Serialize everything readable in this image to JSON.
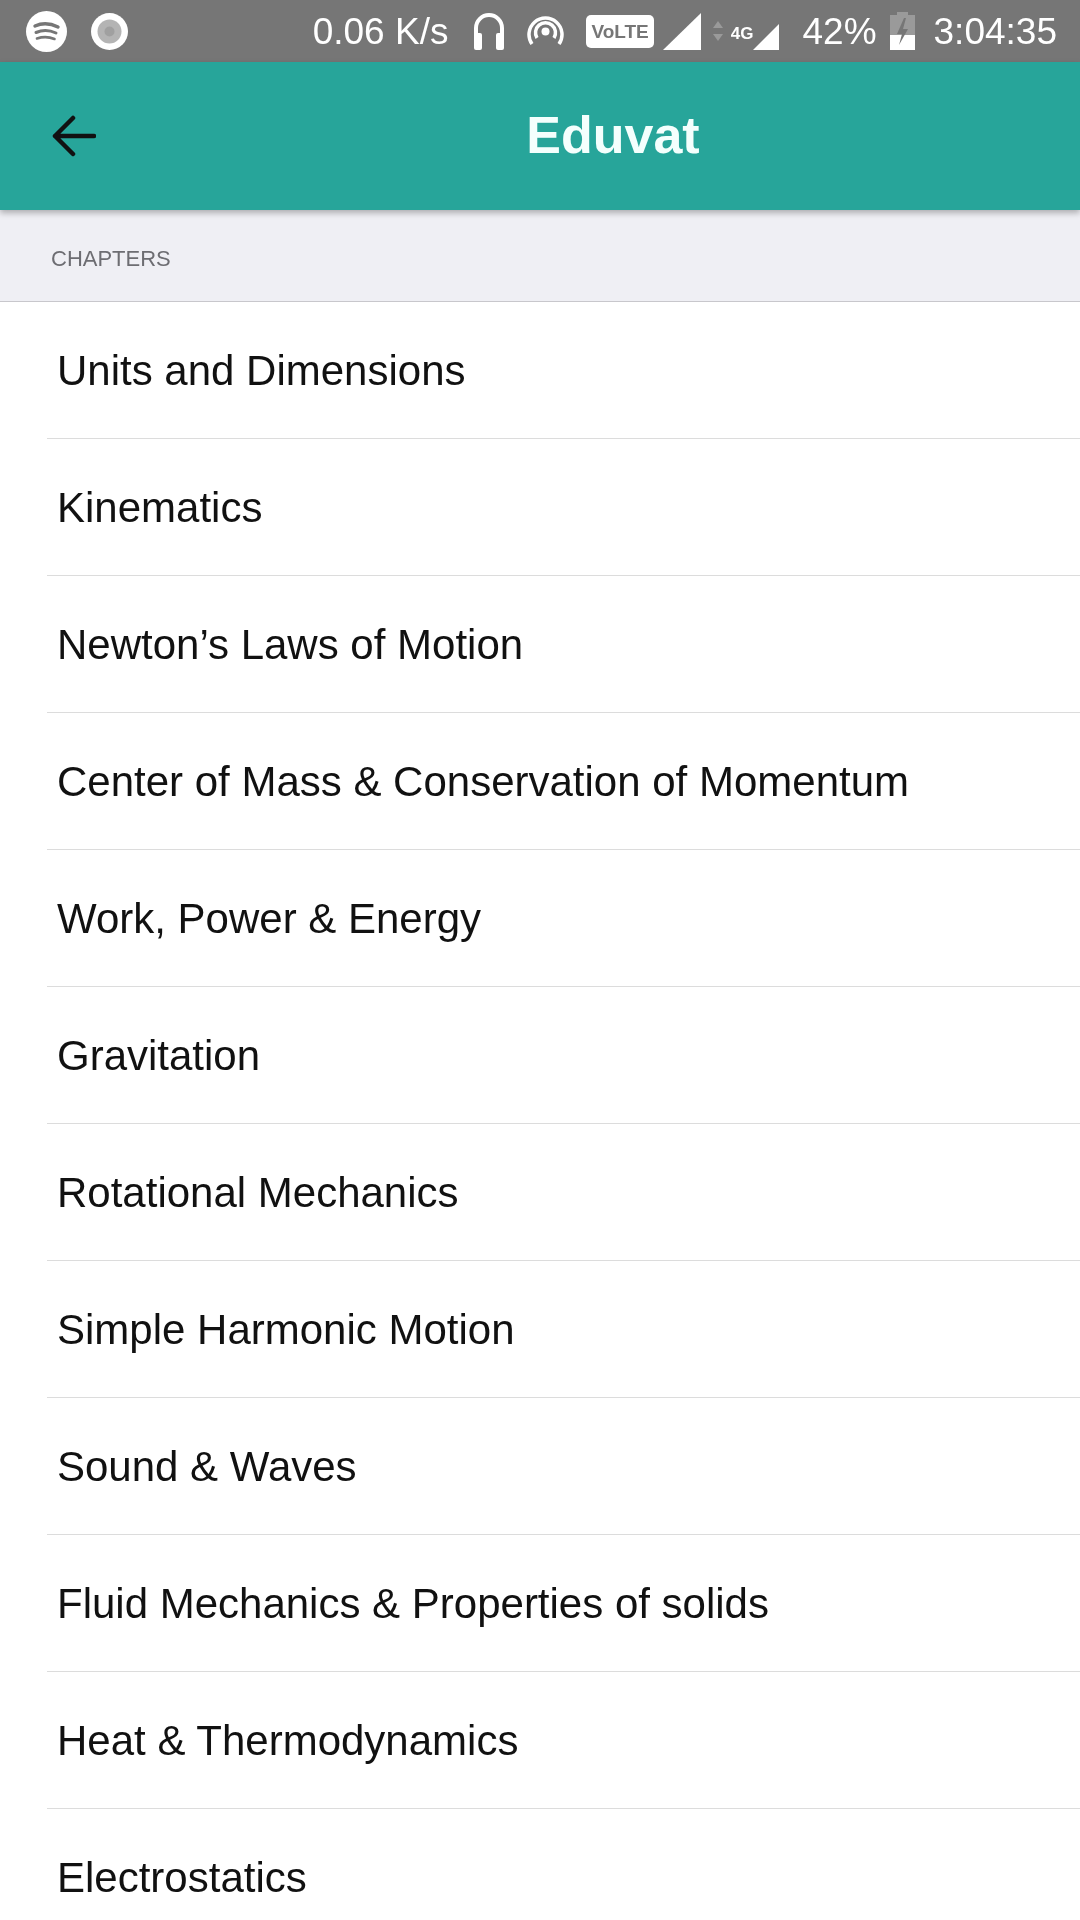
{
  "status_bar": {
    "network_speed": "0.06 K/s",
    "volte": "VoLTE",
    "network_type": "4G",
    "battery": "42%",
    "time": "3:04:35"
  },
  "app_bar": {
    "title": "Eduvat"
  },
  "section": {
    "title": "CHAPTERS"
  },
  "chapters": [
    {
      "title": "Units and Dimensions"
    },
    {
      "title": "Kinematics"
    },
    {
      "title": "Newton’s Laws of Motion"
    },
    {
      "title": "Center of Mass & Conservation of Momentum"
    },
    {
      "title": "Work, Power & Energy"
    },
    {
      "title": "Gravitation"
    },
    {
      "title": "Rotational Mechanics"
    },
    {
      "title": "Simple Harmonic Motion"
    },
    {
      "title": "Sound & Waves"
    },
    {
      "title": "Fluid Mechanics & Properties of solids"
    },
    {
      "title": "Heat & Thermodynamics"
    },
    {
      "title": "Electrostatics"
    }
  ]
}
